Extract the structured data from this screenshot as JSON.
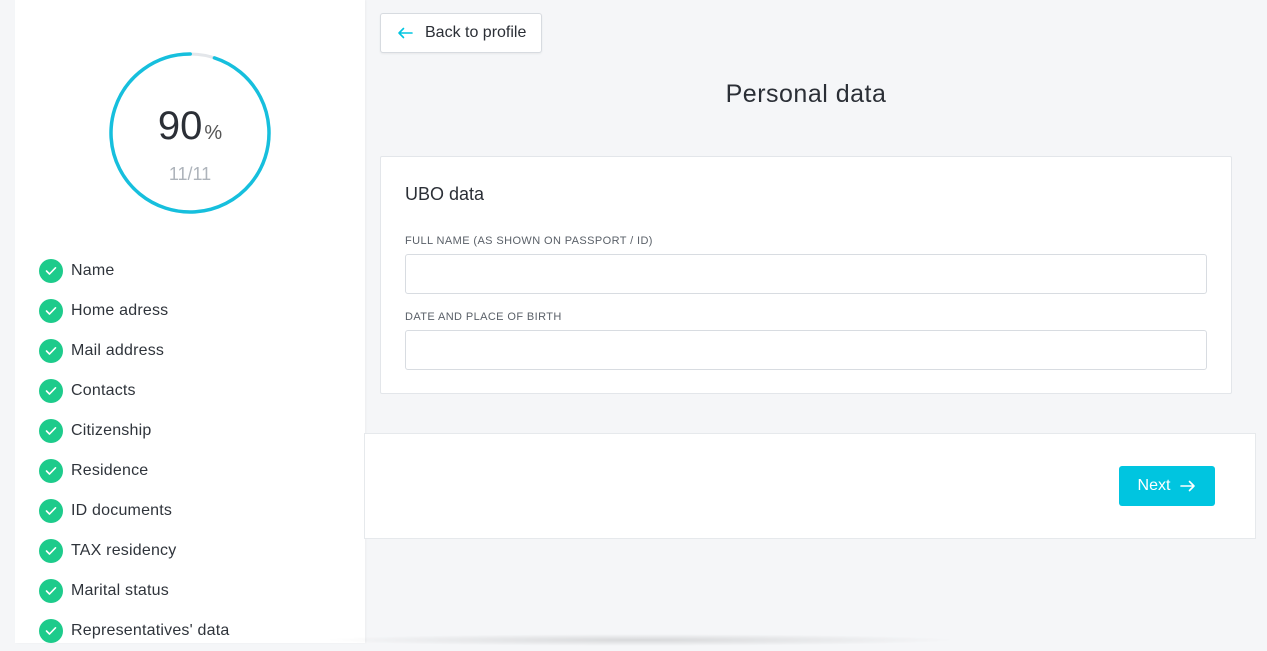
{
  "progress": {
    "percent_value": "90",
    "percent_unit": "%",
    "fraction": 0.95,
    "count_text": "11/11"
  },
  "steps": [
    {
      "label": "Name",
      "done": true
    },
    {
      "label": "Home adress",
      "done": true
    },
    {
      "label": "Mail address",
      "done": true
    },
    {
      "label": "Contacts",
      "done": true
    },
    {
      "label": "Citizenship",
      "done": true
    },
    {
      "label": "Residence",
      "done": true
    },
    {
      "label": "ID documents",
      "done": true
    },
    {
      "label": "TAX residency",
      "done": true
    },
    {
      "label": "Marital status",
      "done": true
    },
    {
      "label": "Representatives' data",
      "done": true
    }
  ],
  "header": {
    "back_label": "Back to profile",
    "title": "Personal data"
  },
  "form": {
    "section_title": "UBO data",
    "full_name_label": "FULL NAME (AS SHOWN ON PASSPORT / ID)",
    "full_name_value": "",
    "birth_label": "DATE AND PLACE OF BIRTH",
    "birth_value": ""
  },
  "footer": {
    "next_label": "Next"
  },
  "icons": {
    "back": "arrow-left-icon",
    "next": "arrow-right-icon",
    "check": "check-icon"
  },
  "colors": {
    "accent": "#00c5e0",
    "success": "#1dcb8b",
    "ring_track": "#e3e6ea"
  }
}
